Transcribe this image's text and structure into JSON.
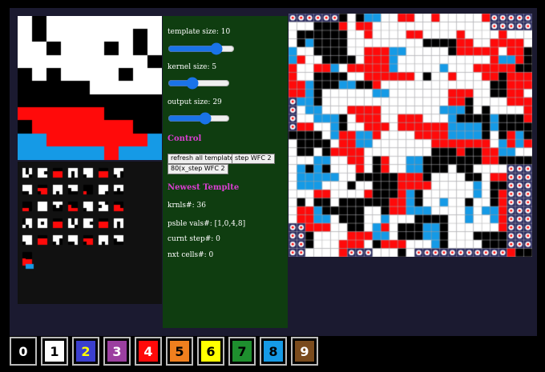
{
  "controls": {
    "template_size": {
      "label": "template size: 10",
      "value": 10,
      "min": 3,
      "max": 12
    },
    "kernel_size": {
      "label": "kernel size: 5",
      "value": 5,
      "min": 2,
      "max": 10
    },
    "output_size": {
      "label": "output size: 29",
      "value": 29,
      "min": 10,
      "max": 40
    },
    "control_heading": "Control",
    "buttons": {
      "refresh": "refresh all template",
      "step": "step WFC 2",
      "step80": "80(x_step WFC 2"
    },
    "newest_heading": "Newest Templte",
    "stats": {
      "krnls": "krnls#: 36",
      "psble": "psble vals#: [1,0,4,8]",
      "curnt": "curnt step#: 0",
      "nxt": "nxt cells#: 0"
    }
  },
  "colors": {
    "0": "#000000",
    "1": "#ffffff",
    "2": "#3b3fcf",
    "3": "#9b3fa0",
    "4": "#ff0a0a",
    "5": "#f07f1e",
    "6": "#ffff00",
    "7": "#1e8f2e",
    "8": "#159ae6",
    "9": "#7a4b1d"
  },
  "palette": [
    {
      "label": "0",
      "color": "#000000",
      "text": "#ffffff"
    },
    {
      "label": "1",
      "color": "#ffffff",
      "text": "#000000"
    },
    {
      "label": "2",
      "color": "#3b3fcf",
      "text": "#ffff00"
    },
    {
      "label": "3",
      "color": "#9b3fa0",
      "text": "#ffffff"
    },
    {
      "label": "4",
      "color": "#ff0a0a",
      "text": "#ffffff"
    },
    {
      "label": "5",
      "color": "#f07f1e",
      "text": "#000000"
    },
    {
      "label": "6",
      "color": "#ffff00",
      "text": "#000000"
    },
    {
      "label": "7",
      "color": "#1e8f2e",
      "text": "#000000"
    },
    {
      "label": "8",
      "color": "#159ae6",
      "text": "#000000"
    },
    {
      "label": "9",
      "color": "#7a4b1d",
      "text": "#ffffff"
    }
  ],
  "template_grid": [
    "1011111111",
    "1011111101",
    "1101110101",
    "1111111110",
    "0101111011",
    "0000011111",
    "0000000000",
    "4444440000",
    "0444444400",
    "8844444448",
    "8888884888"
  ],
  "uncertain_color": "#2a2a60"
}
